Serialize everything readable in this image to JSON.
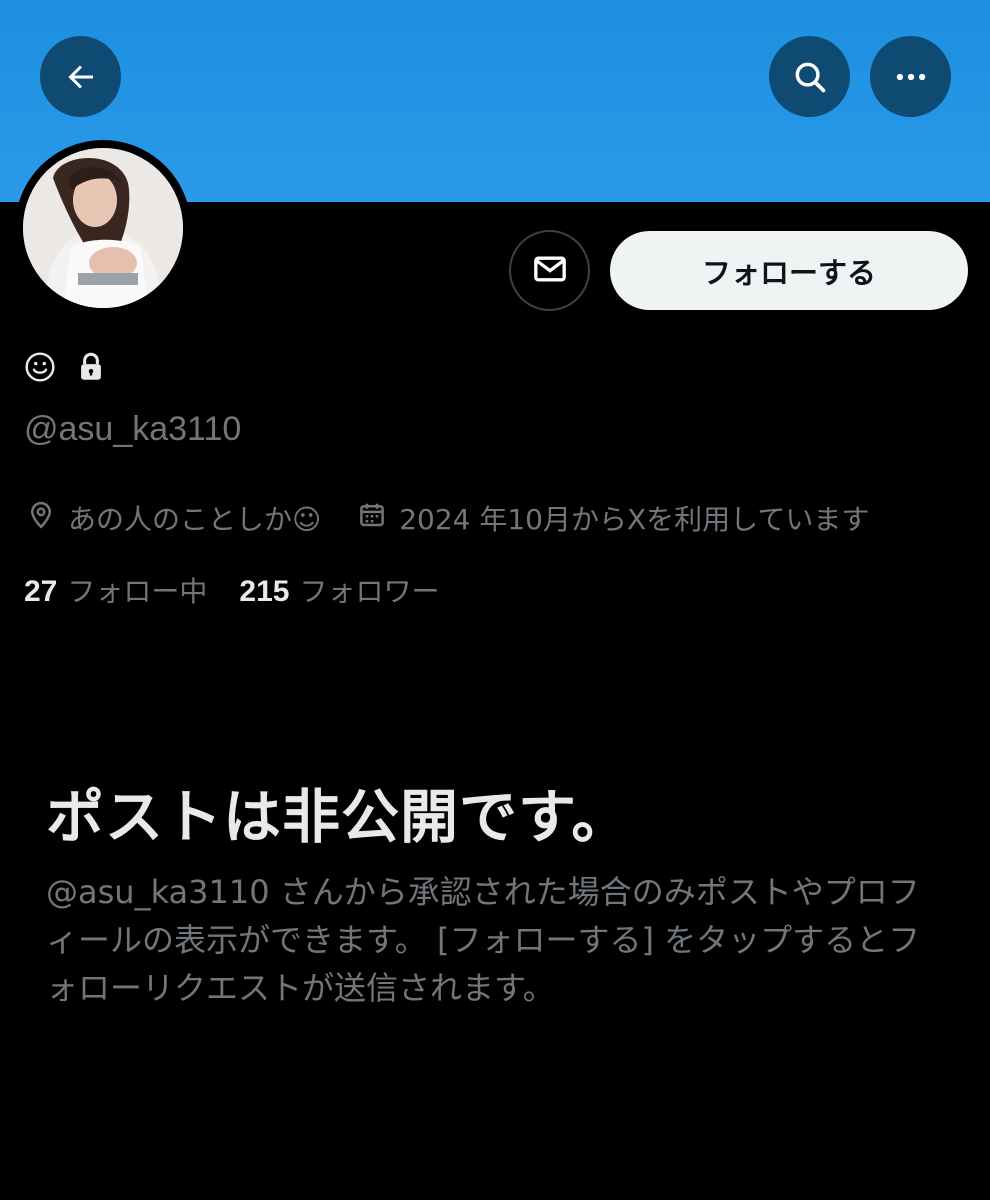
{
  "header": {
    "back_icon": "arrow-left-icon",
    "search_icon": "search-icon",
    "more_icon": "more-horizontal-icon",
    "banner_color": "#1d93e3"
  },
  "profile": {
    "handle": "@asu_ka3110",
    "name_emoji": "☺",
    "protected_icon": "lock-icon",
    "location": "あの人のことしか☺",
    "joined": "2024 年10月からXを利用しています",
    "following_count": "27",
    "following_label": "フォロー中",
    "followers_count": "215",
    "followers_label": "フォロワー"
  },
  "actions": {
    "message_icon": "envelope-icon",
    "follow_label": "フォローする"
  },
  "private_notice": {
    "title": "ポストは非公開です。",
    "description": "@asu_ka3110 さんから承認された場合のみポストやプロフィールの表示ができます。 [フォローする] をタップするとフォローリクエストが送信されます。"
  }
}
